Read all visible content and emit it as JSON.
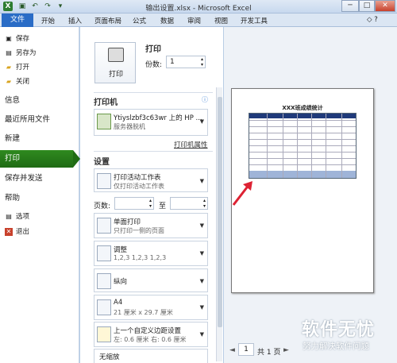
{
  "window": {
    "title": "输出设置.xlsx - Microsoft Excel",
    "min": "─",
    "max": "□",
    "close": "✕"
  },
  "ribbon": {
    "tabs": [
      "文件",
      "开始",
      "插入",
      "页面布局",
      "公式",
      "数据",
      "审阅",
      "视图",
      "开发工具"
    ]
  },
  "left_menu": {
    "save": "保存",
    "save_as": "另存为",
    "open": "打开",
    "close": "关闭",
    "info": "信息",
    "recent": "最近所用文件",
    "new": "新建",
    "print": "打印",
    "save_send": "保存并发送",
    "help": "帮助",
    "options": "选项",
    "exit": "退出"
  },
  "print": {
    "heading": "打印",
    "print_button": "打印",
    "copies_label": "份数:",
    "copies_value": "1"
  },
  "printer": {
    "heading": "打印机",
    "info_icon": "ⓘ",
    "name": "Ytiyslzbf3c63wr 上的 HP ...",
    "status": "服务器脱机",
    "properties_link": "打印机属性"
  },
  "settings": {
    "heading": "设置",
    "what": {
      "line1": "打印活动工作表",
      "line2": "仅打印活动工作表"
    },
    "pages_label": "页数:",
    "to_label": "至",
    "sides": {
      "line1": "单面打印",
      "line2": "只打印一侧的页面"
    },
    "collate": {
      "line1": "调整",
      "line2": "1,2,3    1,2,3    1,2,3"
    },
    "orientation": {
      "line1": "纵向"
    },
    "paper": {
      "line1": "A4",
      "line2": "21 厘米 x 29.7 厘米"
    },
    "margins": {
      "line1": "上一个自定义边距设置",
      "line2": "左: 0.6 厘米    右: 0.6 厘米"
    },
    "scaling": {
      "line1": "无缩放"
    }
  },
  "preview": {
    "sheet_title": "XXX班成绩统计",
    "page_value": "1",
    "page_total": "共 1 页"
  },
  "watermark": {
    "title": "软件无忧",
    "subtitle": "努力解决软件问题"
  }
}
